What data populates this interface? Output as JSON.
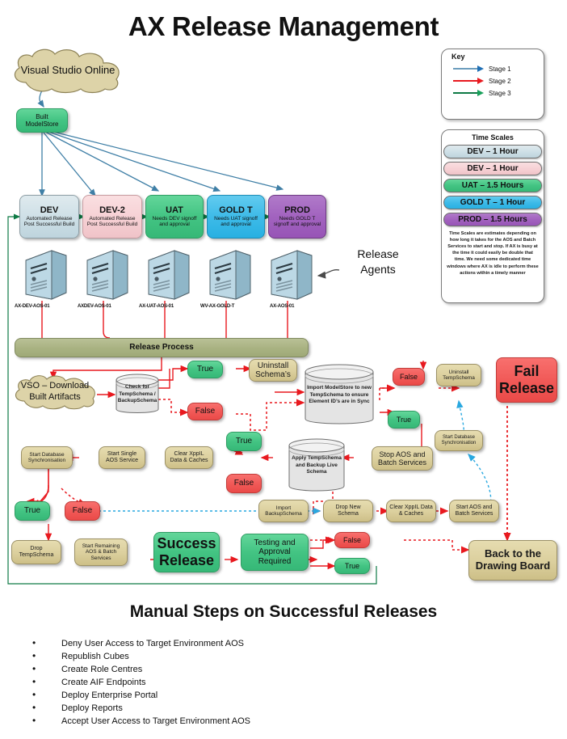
{
  "title": "AX Release Management",
  "manual_title": "Manual Steps on Successful Releases",
  "source": {
    "label": "Visual Studio Online"
  },
  "built": {
    "label": "Built ModelStore"
  },
  "key": {
    "title": "Key",
    "items": [
      {
        "label": "Stage 1",
        "color": "#4f88ab"
      },
      {
        "label": "Stage 2",
        "color": "#e8191f"
      },
      {
        "label": "Stage 3",
        "color": "#0e7a45"
      }
    ]
  },
  "timescales": {
    "title": "Time Scales",
    "pills": [
      {
        "label": "DEV – 1 Hour",
        "style": "lightblue"
      },
      {
        "label": "DEV – 1 Hour",
        "style": "pink"
      },
      {
        "label": "UAT – 1.5 Hours",
        "style": "green"
      },
      {
        "label": "GOLD T – 1 Hour",
        "style": "cyan"
      },
      {
        "label": "PROD – 1.5 Hours",
        "style": "purple"
      }
    ],
    "note": "Time Scales are estimates depending on how long it takes for the AOS and Batch Services to start and stop. If AX is busy at the time it could easily be double that time. We need some dedicated time windows where AX is idle to perform these actions within a timely manner"
  },
  "environments": [
    {
      "name": "DEV",
      "desc": "Automated Release Post Successful Build",
      "style": "lightblue"
    },
    {
      "name": "DEV-2",
      "desc": "Automated Release Post Successful Build",
      "style": "pink"
    },
    {
      "name": "UAT",
      "desc": "Needs DEV signoff and approval",
      "style": "green"
    },
    {
      "name": "GOLD T",
      "desc": "Needs UAT signoff and approval",
      "style": "cyan"
    },
    {
      "name": "PROD",
      "desc": "Needs GOLD T signoff and approval",
      "style": "purple"
    }
  ],
  "servers": [
    {
      "label": "AX-DEV-AOS-01"
    },
    {
      "label": "AXDEV-AOS-01"
    },
    {
      "label": "AX-UAT-AOS-01"
    },
    {
      "label": "WV-AX-GOLD-T"
    },
    {
      "label": "AX-AOS-01"
    }
  ],
  "release_agents_label": "Release Agents",
  "release_process": {
    "label": "Release Process"
  },
  "flow": {
    "vso_download": "VSO – Download Built Artifacts",
    "check_temp": "Check for TempSchema / BackupSchema",
    "true_1": "True",
    "false_1": "False",
    "uninstall_schemas": "Uninstall Schema’s",
    "import_modelstore": "Import ModelStore to new TempSchema to ensure Element ID’s are in Sync",
    "false_2": "False",
    "true_2": "True",
    "uninstall_tempschema": "Uninstall TempSchema",
    "fail_release": "Fail Release",
    "start_db_sync_right": "Start Database Synchronisation",
    "stop_aos": "Stop AOS and Batch Services",
    "apply_temp": "Apply TempSchema and Backup Live Schema",
    "true_3": "True",
    "false_3": "False",
    "clear_xppil_1": "Clear XppIL Data & Caches",
    "start_single_aos": "Start Single AOS Service",
    "start_db_sync_left": "Start Database Synchronisation",
    "true_4": "True",
    "false_4": "False",
    "import_backup": "Import BackupSchema",
    "drop_new_schema": "Drop New Schema",
    "clear_xppil_2": "Clear XppIL Data & Caches",
    "start_aos_batch": "Start AOS and Batch Services",
    "drop_tempschema": "Drop TempSchema",
    "start_remaining": "Start Remaining AOS & Batch Services",
    "success_release": "Success Release",
    "testing_approval": "Testing and Approval Required",
    "false_5": "False",
    "true_5": "True",
    "back_drawing": "Back to the Drawing Board"
  },
  "manual_steps": [
    "Deny User Access to Target Environment AOS",
    "Republish Cubes",
    "Create Role Centres",
    "Create AIF Endpoints",
    "Deploy Enterprise Portal",
    "Deploy Reports",
    "Accept User Access to Target Environment AOS"
  ],
  "colors": {
    "stage1": "#4f88ab",
    "stage2": "#e8191f",
    "stage3": "#0e7a45",
    "sync_blue": "#29a8e0"
  }
}
